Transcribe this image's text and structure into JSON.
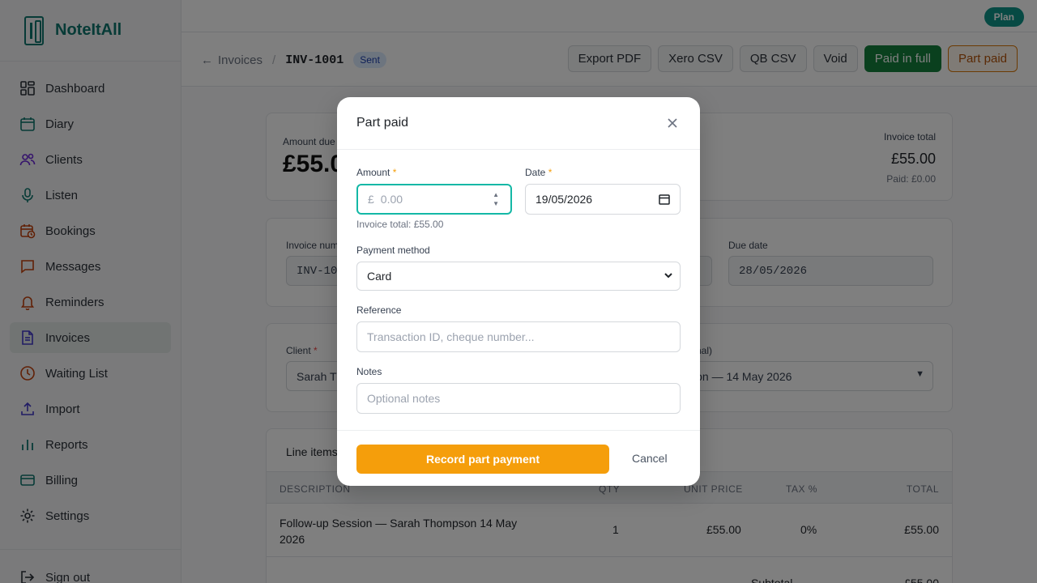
{
  "app": {
    "name": "NoteItAll",
    "plan_label": "Plan"
  },
  "sidebar": {
    "items": [
      {
        "label": "Dashboard",
        "icon": "dashboard-icon"
      },
      {
        "label": "Diary",
        "icon": "calendar-icon"
      },
      {
        "label": "Clients",
        "icon": "users-icon"
      },
      {
        "label": "Listen",
        "icon": "microphone-icon"
      },
      {
        "label": "Bookings",
        "icon": "calendar-clock-icon"
      },
      {
        "label": "Messages",
        "icon": "message-icon"
      },
      {
        "label": "Reminders",
        "icon": "bell-icon"
      },
      {
        "label": "Invoices",
        "icon": "document-icon"
      },
      {
        "label": "Waiting List",
        "icon": "clock-icon"
      },
      {
        "label": "Import",
        "icon": "upload-icon"
      },
      {
        "label": "Reports",
        "icon": "bar-chart-icon"
      },
      {
        "label": "Billing",
        "icon": "credit-card-icon"
      },
      {
        "label": "Settings",
        "icon": "gear-icon"
      }
    ],
    "active_index": 7,
    "sign_out": "Sign out"
  },
  "header": {
    "breadcrumb_parent": "Invoices",
    "separator": "/",
    "invoice_number": "INV-1001",
    "status": "Sent",
    "actions": {
      "export_pdf": "Export PDF",
      "xero_csv": "Xero CSV",
      "qb_csv": "QB CSV",
      "void": "Void",
      "paid_in_full": "Paid in full",
      "part_paid": "Part paid"
    }
  },
  "summary": {
    "amount_due_label": "Amount due",
    "amount_due_value": "£55.0",
    "invoice_total_label": "Invoice total",
    "invoice_total_value": "£55.00",
    "paid_text": "Paid: £0.00"
  },
  "details": {
    "invoice_number_label": "Invoice num",
    "invoice_number_value": "INV-10",
    "due_date_label": "Due date",
    "due_date_value": "28/05/2026"
  },
  "client_section": {
    "client_label": "Client",
    "client_value": "Sarah T",
    "session_label_partial": "nal)",
    "session_value": "ssion — 14 May 2026"
  },
  "line_items": {
    "title": "Line items",
    "columns": [
      "DESCRIPTION",
      "QTY",
      "UNIT PRICE",
      "TAX %",
      "TOTAL"
    ],
    "rows": [
      {
        "description": "Follow-up Session — Sarah Thompson 14 May 2026",
        "qty": "1",
        "unit_price": "£55.00",
        "tax": "0%",
        "total": "£55.00"
      }
    ],
    "subtotal_label": "Subtotal",
    "subtotal_value": "£55.00"
  },
  "modal": {
    "title": "Part paid",
    "amount_label": "Amount",
    "amount_currency": "£",
    "amount_placeholder": "0.00",
    "amount_hint": "Invoice total: £55.00",
    "date_label": "Date",
    "date_value": "19/05/2026",
    "payment_method_label": "Payment method",
    "payment_method_value": "Card",
    "reference_label": "Reference",
    "reference_placeholder": "Transaction ID, cheque number...",
    "notes_label": "Notes",
    "notes_placeholder": "Optional notes",
    "submit_label": "Record part payment",
    "cancel_label": "Cancel",
    "required_mark": "*"
  },
  "colors": {
    "brand": "#0f766e",
    "paid_in_full": "#15803d",
    "accent_orange": "#f59e0b",
    "focus_ring": "#14b8a6"
  }
}
